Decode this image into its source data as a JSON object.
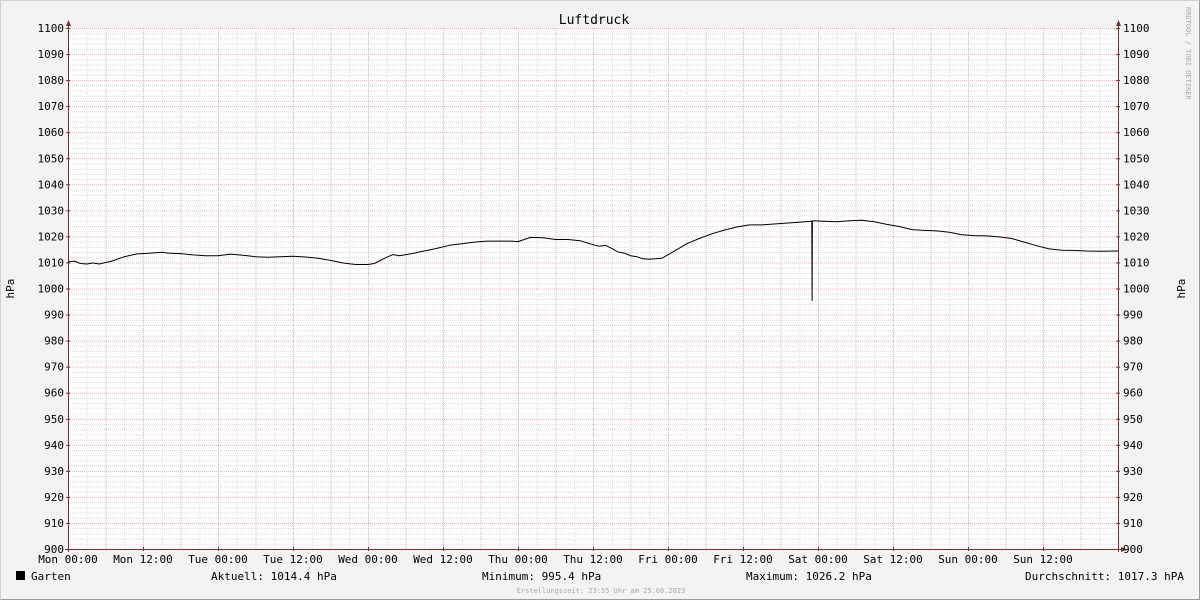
{
  "chart_data": {
    "type": "line",
    "title": "Luftdruck",
    "ylabel": "hPa",
    "ylim": [
      900,
      1100
    ],
    "y_ticks": [
      900,
      910,
      920,
      930,
      940,
      950,
      960,
      970,
      980,
      990,
      1000,
      1010,
      1020,
      1030,
      1040,
      1050,
      1060,
      1070,
      1080,
      1090,
      1100
    ],
    "x_ticks": [
      "Mon 00:00",
      "Mon 12:00",
      "Tue 00:00",
      "Tue 12:00",
      "Wed 00:00",
      "Wed 12:00",
      "Thu 00:00",
      "Thu 12:00",
      "Fri 00:00",
      "Fri 12:00",
      "Sat 00:00",
      "Sat 12:00",
      "Sun 00:00",
      "Sun 12:00"
    ],
    "x_unit": "hours since Mon 00:00",
    "xlim": [
      0,
      168
    ],
    "grid": true,
    "series": [
      {
        "name": "Garten",
        "color": "#000000",
        "x": [
          0,
          1,
          2,
          3,
          4,
          5,
          7,
          9,
          11,
          13,
          15,
          16,
          18,
          20,
          22,
          24,
          26,
          28,
          30,
          32,
          34,
          36,
          38,
          40,
          42,
          44,
          46,
          48,
          49,
          50,
          51,
          52,
          53,
          55,
          57,
          59,
          61,
          63,
          65,
          67,
          69,
          70,
          71,
          72,
          74,
          76,
          78,
          80,
          82,
          84,
          85,
          86,
          87,
          88,
          89,
          90,
          91,
          92,
          93,
          95,
          97,
          99,
          101,
          103,
          105,
          107,
          109,
          111,
          118,
          119,
          119.05,
          119.1,
          119.2,
          121,
          123,
          125,
          127,
          129,
          131,
          133,
          135,
          137,
          139,
          141,
          143,
          145,
          147,
          149,
          151,
          153,
          155,
          157,
          159,
          161,
          163,
          165,
          168
        ],
        "values": [
          1010.2,
          1010.5,
          1009.6,
          1009.4,
          1009.8,
          1009.4,
          1010.5,
          1012.2,
          1013.3,
          1013.5,
          1013.9,
          1013.6,
          1013.4,
          1012.9,
          1012.6,
          1012.6,
          1013.2,
          1012.8,
          1012.2,
          1012.0,
          1012.2,
          1012.4,
          1012.1,
          1011.6,
          1010.8,
          1009.8,
          1009.2,
          1009.2,
          1009.6,
          1010.8,
          1012.0,
          1013.0,
          1012.6,
          1013.4,
          1014.4,
          1015.4,
          1016.6,
          1017.2,
          1017.8,
          1018.2,
          1018.2,
          1018.2,
          1018.2,
          1018.0,
          1019.6,
          1019.5,
          1018.8,
          1018.8,
          1018.3,
          1016.8,
          1016.2,
          1016.6,
          1015.4,
          1014.0,
          1013.6,
          1012.6,
          1012.2,
          1011.4,
          1011.2,
          1011.6,
          1014.3,
          1017.2,
          1019.2,
          1021.0,
          1022.4,
          1023.6,
          1024.4,
          1024.4,
          1025.6,
          1025.8,
          995.4,
          1025.9,
          1026.0,
          1025.8,
          1025.6,
          1026.0,
          1026.2,
          1025.6,
          1024.6,
          1023.8,
          1022.6,
          1022.3,
          1022.1,
          1021.6,
          1020.6,
          1020.3,
          1020.2,
          1019.8,
          1019.2,
          1017.8,
          1016.4,
          1015.2,
          1014.7,
          1014.6,
          1014.4,
          1014.3,
          1014.4
        ]
      }
    ],
    "legend": {
      "name": "Garten",
      "swatch_color": "#000000",
      "position": "bottom-left"
    }
  },
  "stats": {
    "aktuell": "Aktuell: 1014.4 hPa",
    "minimum": "Minimum: 995.4 hPa",
    "maximum": "Maximum: 1026.2 hPa",
    "durchschnitt": "Durchschnitt: 1017.3 hPA"
  },
  "footer": "Erstellungszeit: 23:55 Uhr am 25.06.2023",
  "watermark": "RRDTOOL / TOBI OETIKER",
  "colors": {
    "background": "#f3f3f3",
    "canvas": "#ffffff",
    "major_grid": "#f0b0b0",
    "minor_grid": "#dddddd",
    "axis": "#7a2d2d",
    "line": "#000000"
  }
}
